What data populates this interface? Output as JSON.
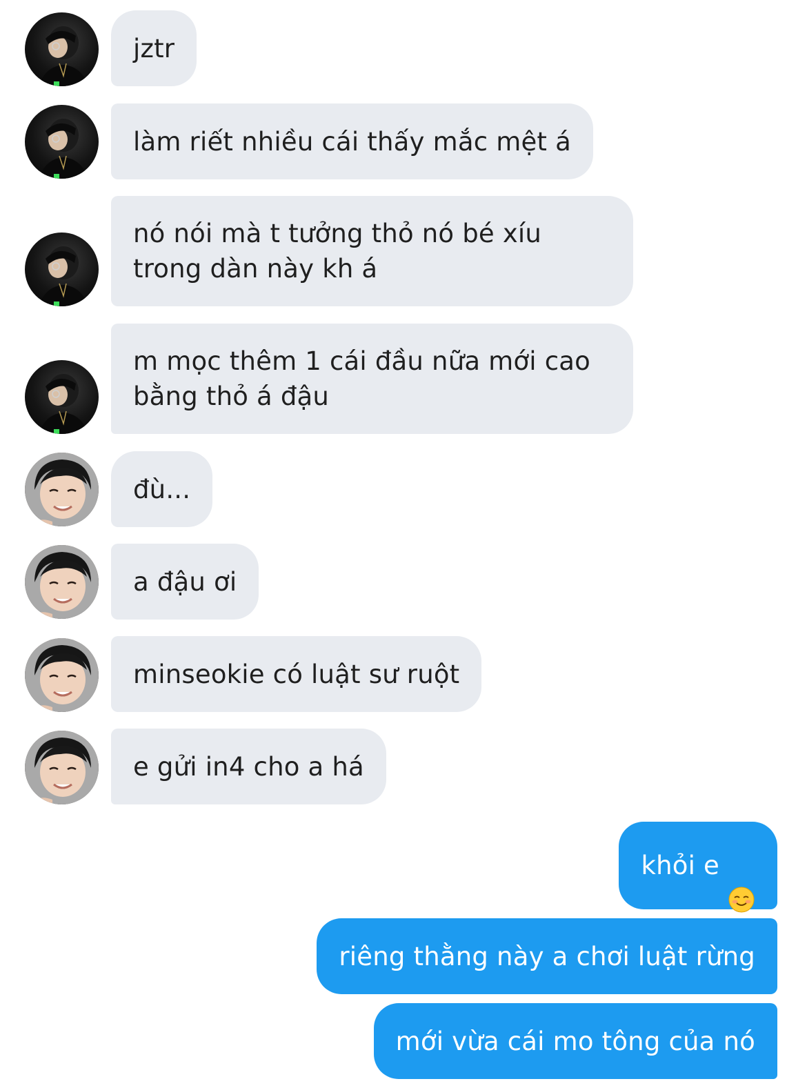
{
  "conversation": {
    "messages": [
      {
        "sender": "other_a",
        "text": "jztr"
      },
      {
        "sender": "other_a",
        "text": "làm riết nhiều cái thấy mắc mệt á"
      },
      {
        "sender": "other_a",
        "text": "nó nói mà t tưởng thỏ nó bé xíu\ntrong dàn này kh á"
      },
      {
        "sender": "other_a",
        "text": "m mọc thêm 1 cái đầu nữa mới cao\nbằng thỏ á đậu"
      },
      {
        "sender": "other_b",
        "text": "đù..."
      },
      {
        "sender": "other_b",
        "text": "a đậu ơi"
      },
      {
        "sender": "other_b",
        "text": "minseokie có luật sư ruột"
      },
      {
        "sender": "other_b",
        "text": "e gửi in4 cho a há"
      },
      {
        "sender": "me",
        "text": "khỏi e",
        "emoji": "smiling-face-icon"
      },
      {
        "sender": "me",
        "text": "riêng thằng này a chơi luật rừng"
      },
      {
        "sender": "me",
        "text": "mới vừa cái mo tông của nó"
      }
    ]
  },
  "colors": {
    "incoming_bubble": "#e8ebf0",
    "outgoing_bubble": "#1d9bf0",
    "incoming_text": "#1f1f1f",
    "outgoing_text": "#ffffff"
  }
}
